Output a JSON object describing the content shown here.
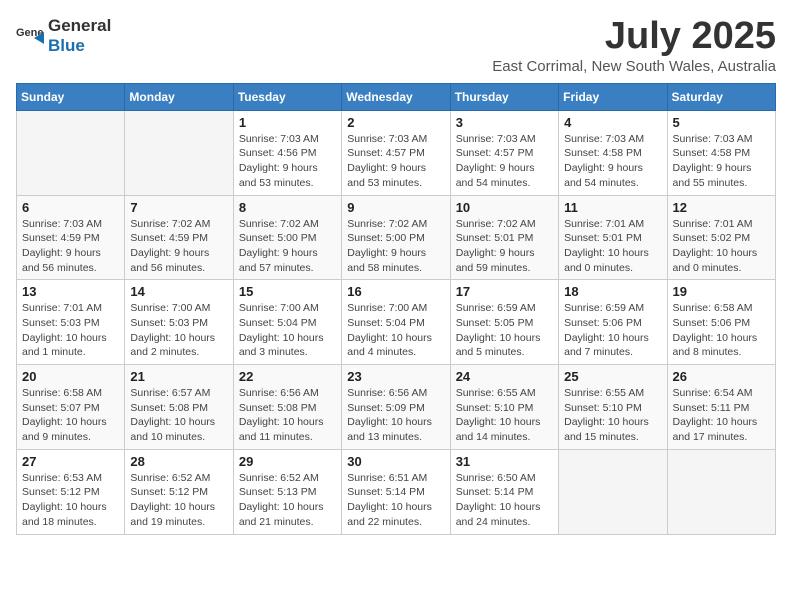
{
  "header": {
    "logo_general": "General",
    "logo_blue": "Blue",
    "month": "July 2025",
    "location": "East Corrimal, New South Wales, Australia"
  },
  "weekdays": [
    "Sunday",
    "Monday",
    "Tuesday",
    "Wednesday",
    "Thursday",
    "Friday",
    "Saturday"
  ],
  "weeks": [
    [
      {
        "day": "",
        "info": ""
      },
      {
        "day": "",
        "info": ""
      },
      {
        "day": "1",
        "info": "Sunrise: 7:03 AM\nSunset: 4:56 PM\nDaylight: 9 hours and 53 minutes."
      },
      {
        "day": "2",
        "info": "Sunrise: 7:03 AM\nSunset: 4:57 PM\nDaylight: 9 hours and 53 minutes."
      },
      {
        "day": "3",
        "info": "Sunrise: 7:03 AM\nSunset: 4:57 PM\nDaylight: 9 hours and 54 minutes."
      },
      {
        "day": "4",
        "info": "Sunrise: 7:03 AM\nSunset: 4:58 PM\nDaylight: 9 hours and 54 minutes."
      },
      {
        "day": "5",
        "info": "Sunrise: 7:03 AM\nSunset: 4:58 PM\nDaylight: 9 hours and 55 minutes."
      }
    ],
    [
      {
        "day": "6",
        "info": "Sunrise: 7:03 AM\nSunset: 4:59 PM\nDaylight: 9 hours and 56 minutes."
      },
      {
        "day": "7",
        "info": "Sunrise: 7:02 AM\nSunset: 4:59 PM\nDaylight: 9 hours and 56 minutes."
      },
      {
        "day": "8",
        "info": "Sunrise: 7:02 AM\nSunset: 5:00 PM\nDaylight: 9 hours and 57 minutes."
      },
      {
        "day": "9",
        "info": "Sunrise: 7:02 AM\nSunset: 5:00 PM\nDaylight: 9 hours and 58 minutes."
      },
      {
        "day": "10",
        "info": "Sunrise: 7:02 AM\nSunset: 5:01 PM\nDaylight: 9 hours and 59 minutes."
      },
      {
        "day": "11",
        "info": "Sunrise: 7:01 AM\nSunset: 5:01 PM\nDaylight: 10 hours and 0 minutes."
      },
      {
        "day": "12",
        "info": "Sunrise: 7:01 AM\nSunset: 5:02 PM\nDaylight: 10 hours and 0 minutes."
      }
    ],
    [
      {
        "day": "13",
        "info": "Sunrise: 7:01 AM\nSunset: 5:03 PM\nDaylight: 10 hours and 1 minute."
      },
      {
        "day": "14",
        "info": "Sunrise: 7:00 AM\nSunset: 5:03 PM\nDaylight: 10 hours and 2 minutes."
      },
      {
        "day": "15",
        "info": "Sunrise: 7:00 AM\nSunset: 5:04 PM\nDaylight: 10 hours and 3 minutes."
      },
      {
        "day": "16",
        "info": "Sunrise: 7:00 AM\nSunset: 5:04 PM\nDaylight: 10 hours and 4 minutes."
      },
      {
        "day": "17",
        "info": "Sunrise: 6:59 AM\nSunset: 5:05 PM\nDaylight: 10 hours and 5 minutes."
      },
      {
        "day": "18",
        "info": "Sunrise: 6:59 AM\nSunset: 5:06 PM\nDaylight: 10 hours and 7 minutes."
      },
      {
        "day": "19",
        "info": "Sunrise: 6:58 AM\nSunset: 5:06 PM\nDaylight: 10 hours and 8 minutes."
      }
    ],
    [
      {
        "day": "20",
        "info": "Sunrise: 6:58 AM\nSunset: 5:07 PM\nDaylight: 10 hours and 9 minutes."
      },
      {
        "day": "21",
        "info": "Sunrise: 6:57 AM\nSunset: 5:08 PM\nDaylight: 10 hours and 10 minutes."
      },
      {
        "day": "22",
        "info": "Sunrise: 6:56 AM\nSunset: 5:08 PM\nDaylight: 10 hours and 11 minutes."
      },
      {
        "day": "23",
        "info": "Sunrise: 6:56 AM\nSunset: 5:09 PM\nDaylight: 10 hours and 13 minutes."
      },
      {
        "day": "24",
        "info": "Sunrise: 6:55 AM\nSunset: 5:10 PM\nDaylight: 10 hours and 14 minutes."
      },
      {
        "day": "25",
        "info": "Sunrise: 6:55 AM\nSunset: 5:10 PM\nDaylight: 10 hours and 15 minutes."
      },
      {
        "day": "26",
        "info": "Sunrise: 6:54 AM\nSunset: 5:11 PM\nDaylight: 10 hours and 17 minutes."
      }
    ],
    [
      {
        "day": "27",
        "info": "Sunrise: 6:53 AM\nSunset: 5:12 PM\nDaylight: 10 hours and 18 minutes."
      },
      {
        "day": "28",
        "info": "Sunrise: 6:52 AM\nSunset: 5:12 PM\nDaylight: 10 hours and 19 minutes."
      },
      {
        "day": "29",
        "info": "Sunrise: 6:52 AM\nSunset: 5:13 PM\nDaylight: 10 hours and 21 minutes."
      },
      {
        "day": "30",
        "info": "Sunrise: 6:51 AM\nSunset: 5:14 PM\nDaylight: 10 hours and 22 minutes."
      },
      {
        "day": "31",
        "info": "Sunrise: 6:50 AM\nSunset: 5:14 PM\nDaylight: 10 hours and 24 minutes."
      },
      {
        "day": "",
        "info": ""
      },
      {
        "day": "",
        "info": ""
      }
    ]
  ]
}
